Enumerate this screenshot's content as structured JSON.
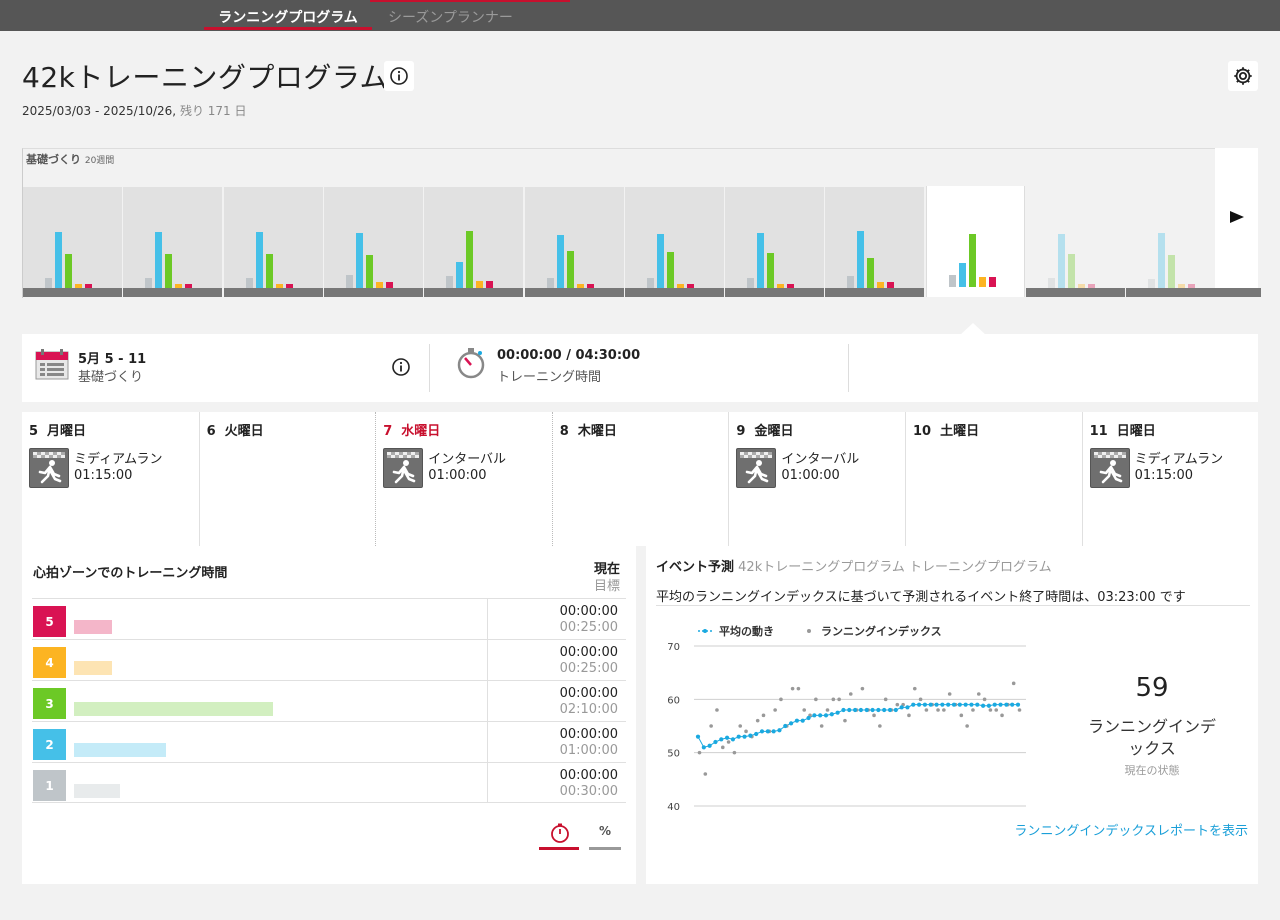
{
  "nav": {
    "tabs": [
      {
        "label": "ランニングプログラム",
        "active": true
      },
      {
        "label": "シーズンプランナー",
        "active": false
      }
    ]
  },
  "program": {
    "title": "42kトレーニングプログラム",
    "date_range": "2025/03/03 - 2025/10/26,",
    "remaining_label": "残り",
    "remaining_days": "171 日"
  },
  "phase": {
    "label": "基礎づくり",
    "weeks_label": "20週間"
  },
  "week_bars": {
    "colors": [
      "#bfc5c9",
      "#45c0e8",
      "#6cc926",
      "#fcb422",
      "#d91353"
    ],
    "weeks": [
      [
        0.09,
        0.51,
        0.31,
        0.04,
        0.04
      ],
      [
        0.09,
        0.51,
        0.31,
        0.04,
        0.04
      ],
      [
        0.09,
        0.51,
        0.31,
        0.04,
        0.04
      ],
      [
        0.12,
        0.5,
        0.3,
        0.05,
        0.05
      ],
      [
        0.11,
        0.24,
        0.52,
        0.06,
        0.06
      ],
      [
        0.09,
        0.48,
        0.34,
        0.04,
        0.04
      ],
      [
        0.09,
        0.49,
        0.33,
        0.04,
        0.04
      ],
      [
        0.09,
        0.5,
        0.32,
        0.04,
        0.04
      ],
      [
        0.11,
        0.52,
        0.27,
        0.05,
        0.05
      ],
      [
        0.11,
        0.22,
        0.48,
        0.09,
        0.09
      ],
      [
        0.09,
        0.49,
        0.31,
        0.04,
        0.04
      ],
      [
        0.08,
        0.5,
        0.3,
        0.04,
        0.04
      ]
    ],
    "selected_index": 9
  },
  "week_info": {
    "range": "5月 5 - 11",
    "phase": "基礎づくり",
    "time": "00:00:00 / 04:30:00",
    "time_label": "トレーニング時間"
  },
  "days": [
    {
      "num": "5",
      "name": "月曜日",
      "today": false,
      "workout": "ミディアムラン",
      "duration": "01:15:00"
    },
    {
      "num": "6",
      "name": "火曜日",
      "today": false,
      "workout": "",
      "duration": ""
    },
    {
      "num": "7",
      "name": "水曜日",
      "today": true,
      "workout": "インターバル",
      "duration": "01:00:00"
    },
    {
      "num": "8",
      "name": "木曜日",
      "today": false,
      "workout": "",
      "duration": ""
    },
    {
      "num": "9",
      "name": "金曜日",
      "today": false,
      "workout": "インターバル",
      "duration": "01:00:00"
    },
    {
      "num": "10",
      "name": "土曜日",
      "today": false,
      "workout": "",
      "duration": ""
    },
    {
      "num": "11",
      "name": "日曜日",
      "today": false,
      "workout": "ミディアムラン",
      "duration": "01:15:00"
    }
  ],
  "hr_zones": {
    "title": "心拍ゾーンでのトレーニング時間",
    "current_label": "現在",
    "target_label": "目標",
    "zones": [
      {
        "zone": "5",
        "color": "#d91353",
        "light": "#f4b6c9",
        "target_fraction": 0.19,
        "current": "00:00:00",
        "target": "00:25:00"
      },
      {
        "zone": "4",
        "color": "#fcb422",
        "light": "#fde4b3",
        "target_fraction": 0.19,
        "current": "00:00:00",
        "target": "00:25:00"
      },
      {
        "zone": "3",
        "color": "#6cc926",
        "light": "#d2efc0",
        "target_fraction": 1.0,
        "current": "00:00:00",
        "target": "02:10:00"
      },
      {
        "zone": "2",
        "color": "#45c0e8",
        "light": "#c4ebf8",
        "target_fraction": 0.46,
        "current": "00:00:00",
        "target": "01:00:00"
      },
      {
        "zone": "1",
        "color": "#bfc5c9",
        "light": "#e8ebec",
        "target_fraction": 0.23,
        "current": "00:00:00",
        "target": "00:30:00"
      }
    ],
    "toggle_percent": "%"
  },
  "event": {
    "title": "イベント予測",
    "subtitle": "42kトレーニングプログラム トレーニングプログラム",
    "prediction": "平均のランニングインデックスに基づいて予測されるイベント終了時間は、03:23:00 です",
    "index_value": "59",
    "index_label": "ランニングインデックス",
    "index_status": "現在の状態",
    "report_link": "ランニングインデックスレポートを表示"
  },
  "chart_data": {
    "type": "scatter",
    "title": "",
    "xlabel": "",
    "ylabel": "",
    "ylim": [
      40,
      70
    ],
    "yticks": [
      40,
      50,
      60,
      70
    ],
    "grid": true,
    "legend": "top-left",
    "series": [
      {
        "name": "平均の動き",
        "color": "#1aa9e0",
        "style": "line-dots",
        "values": [
          53,
          51,
          51.3,
          52,
          52.5,
          52.8,
          52.5,
          53,
          53,
          53.2,
          53.5,
          54,
          54,
          54,
          54.2,
          55,
          55.5,
          56,
          56,
          56.5,
          57,
          57,
          57,
          57.2,
          57.5,
          58,
          58,
          58,
          58,
          58,
          58,
          58,
          58,
          58,
          58,
          58.5,
          58.5,
          59,
          59,
          59,
          59,
          59,
          59,
          59,
          59,
          59,
          59,
          59,
          59,
          58.8,
          58.8,
          59,
          59,
          59,
          59,
          59
        ]
      },
      {
        "name": "ランニングインデックス",
        "color": "#999999",
        "style": "dots",
        "values": [
          50,
          46,
          55,
          58,
          51,
          52,
          50,
          55,
          54,
          53,
          56,
          57,
          54,
          58,
          60,
          55,
          62,
          62,
          58,
          57,
          60,
          55,
          58,
          60,
          60,
          56,
          61,
          58,
          62,
          58,
          57,
          55,
          60,
          58,
          59,
          59,
          57,
          62,
          60,
          58,
          59,
          58,
          58,
          61,
          59,
          57,
          55,
          58,
          61,
          60,
          58,
          58,
          57,
          59,
          63,
          58
        ]
      }
    ]
  }
}
